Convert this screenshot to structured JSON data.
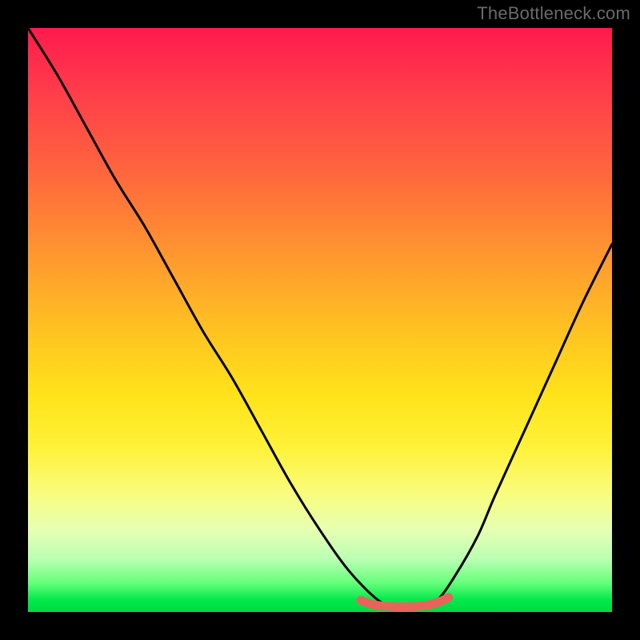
{
  "watermark": "TheBottleneck.com",
  "chart_data": {
    "type": "line",
    "title": "",
    "xlabel": "",
    "ylabel": "",
    "xlim": [
      0,
      100
    ],
    "ylim": [
      0,
      100
    ],
    "series": [
      {
        "name": "bottleneck-curve",
        "x": [
          0,
          5,
          10,
          15,
          20,
          25,
          30,
          35,
          40,
          45,
          50,
          55,
          60,
          63,
          67,
          70,
          73,
          77,
          80,
          85,
          90,
          95,
          100
        ],
        "values": [
          100,
          92,
          83,
          74,
          66,
          57,
          48,
          40,
          31,
          22,
          14,
          7,
          2,
          1,
          1,
          2,
          6,
          13,
          20,
          31,
          42,
          53,
          63
        ]
      },
      {
        "name": "flat-zone-marker",
        "x": [
          57,
          59,
          61,
          63,
          65,
          67,
          69,
          71,
          72
        ],
        "values": [
          2,
          1.3,
          1,
          0.9,
          0.9,
          1,
          1.3,
          2,
          2.5
        ]
      }
    ],
    "gradient_stops": [
      {
        "pos": 0,
        "color": "#ff1a4d"
      },
      {
        "pos": 50,
        "color": "#ffc321"
      },
      {
        "pos": 80,
        "color": "#f8fd80"
      },
      {
        "pos": 100,
        "color": "#00da3f"
      }
    ]
  }
}
